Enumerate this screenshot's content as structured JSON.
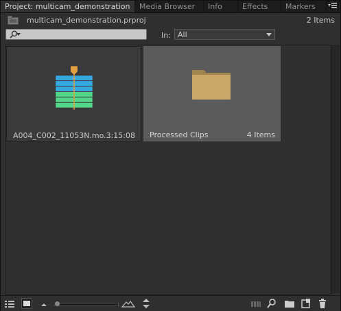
{
  "tabs": [
    {
      "label": "Project: multicam_demonstration",
      "active": true,
      "close": "×"
    },
    {
      "label": "Media Browser",
      "active": false
    },
    {
      "label": "Info",
      "active": false
    },
    {
      "label": "Effects",
      "active": false
    },
    {
      "label": "Markers",
      "active": false
    }
  ],
  "project": {
    "file_name": "multicam_demonstration.prproj",
    "item_count": "2 Items"
  },
  "search": {
    "placeholder": "",
    "value": "",
    "in_label": "In:",
    "in_value": "All"
  },
  "items": [
    {
      "name": "A004_C002_11053N.mo...",
      "meta": "3:15:08",
      "kind": "clip",
      "icon": "multicam-clip-icon"
    },
    {
      "name": "Processed Clips",
      "meta": "4 Items",
      "kind": "bin",
      "icon": "folder-icon",
      "selected": true
    }
  ],
  "colors": {
    "panel_bg": "#2f2f2f",
    "selected_tile": "#5b5b5b",
    "folder": "#c9a86a",
    "clip_blue": "#35a8e0",
    "clip_green": "#52d68a",
    "marker_orange": "#e0a040"
  }
}
